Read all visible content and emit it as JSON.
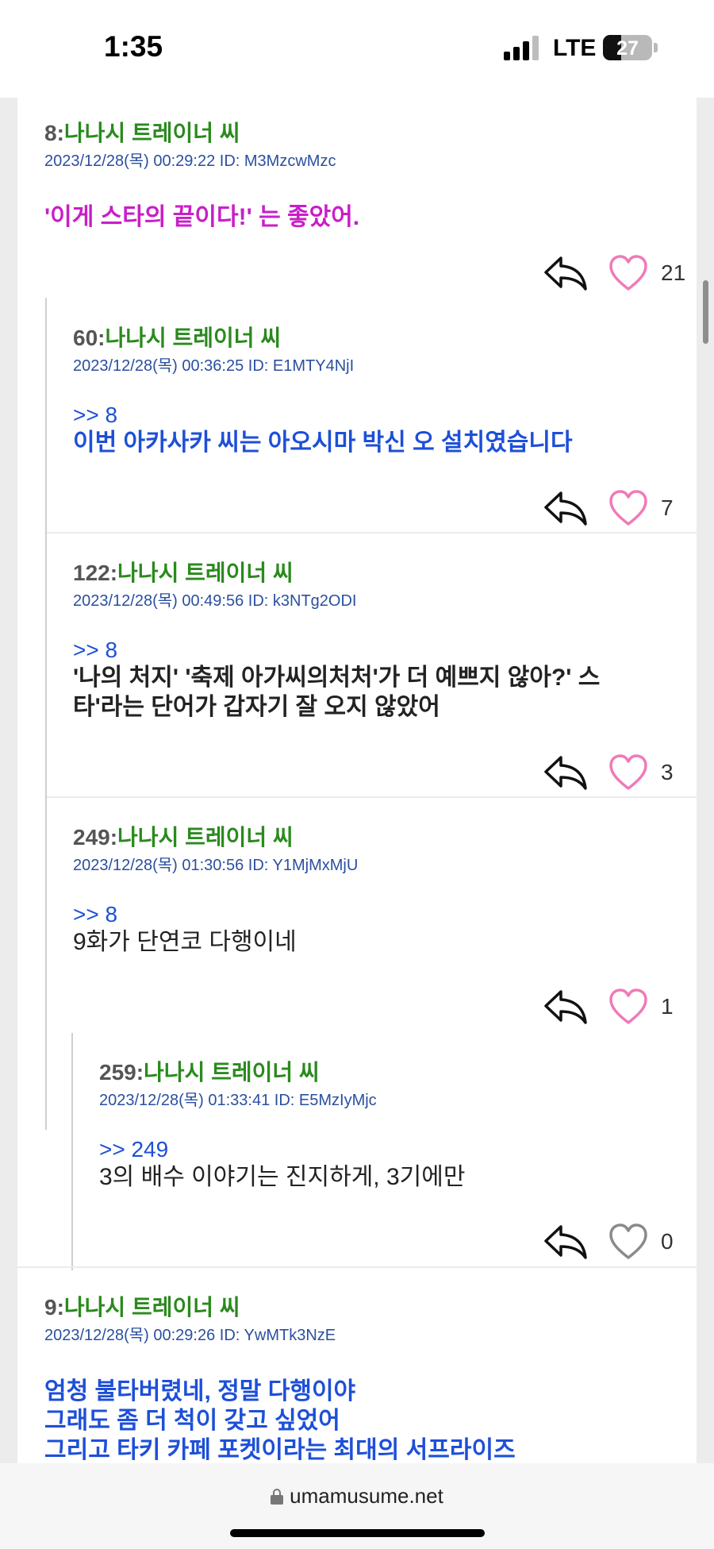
{
  "status_bar": {
    "time": "1:35",
    "network": "LTE",
    "battery": "27"
  },
  "posts": [
    {
      "num": "8:",
      "name": "나나시 트레이너 씨",
      "meta": "2023/12/28(목) 00:29:22 ID: M3MzcwMzc",
      "reply_to": "",
      "lines": [
        "'이게 스타의 끝이다!' 는 좋았어."
      ],
      "likes": "21"
    },
    {
      "num": "60:",
      "name": "나나시 트레이너 씨",
      "meta": "2023/12/28(목) 00:36:25 ID: E1MTY4NjI",
      "reply_to": ">> 8",
      "lines": [
        "이번 아카사카 씨는 아오시마 박신 오 설치였습니다"
      ],
      "likes": "7"
    },
    {
      "num": "122:",
      "name": "나나시 트레이너 씨",
      "meta": "2023/12/28(목) 00:49:56 ID: k3NTg2ODI",
      "reply_to": ">> 8",
      "lines": [
        "'나의 처지' '축제 아가씨의처처'가 더 예쁘지 않아?' 스",
        "타'라는 단어가 갑자기 잘 오지 않았어"
      ],
      "likes": "3"
    },
    {
      "num": "249:",
      "name": "나나시 트레이너 씨",
      "meta": "2023/12/28(목) 01:30:56 ID: Y1MjMxMjU",
      "reply_to": ">> 8",
      "lines": [
        "9화가 단연코 다행이네"
      ],
      "likes": "1"
    },
    {
      "num": "259:",
      "name": "나나시 트레이너 씨",
      "meta": "2023/12/28(목) 01:33:41 ID: E5MzIyMjc",
      "reply_to": ">> 249",
      "lines": [
        "3의 배수 이야기는 진지하게, 3기에만"
      ],
      "likes": "0"
    },
    {
      "num": "9:",
      "name": "나나시 트레이너 씨",
      "meta": "2023/12/28(목) 00:29:26 ID: YwMTk3NzE",
      "reply_to": "",
      "lines": [
        "엄청 불타버렸네, 정말 다행이야",
        "그래도 좀 더 척이 갖고 싶었어",
        "그리고 타키 카페 포켓이라는 최대의 서프라이즈"
      ],
      "likes": ""
    }
  ],
  "url_bar": {
    "url": "umamusume.net"
  },
  "colors": {
    "name": "#2a8a1d",
    "meta": "#2a4fa0",
    "reply_link": "#1d4fd8",
    "highlight_magenta": "#c81ec8",
    "heart_pink": "#f07ab8",
    "heart_gray": "#8a8a8a"
  },
  "icons": {
    "reply": "reply-arrow-icon",
    "like": "heart-icon",
    "secure": "lock-icon"
  }
}
